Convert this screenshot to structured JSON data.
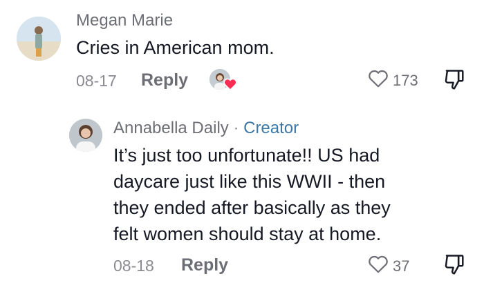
{
  "comments": [
    {
      "author": "Megan Marie",
      "text": "Cries in American mom.",
      "date": "08-17",
      "reply_label": "Reply",
      "like_count": "173",
      "creator_liked": true
    }
  ],
  "reply": {
    "author": "Annabella Daily",
    "badge_sep": " · ",
    "badge": "Creator",
    "text_lines": [
      "It’s just too unfortunate!! US had",
      "daycare just like this WWII - then",
      "they ended after basically as they",
      "felt women should stay at home."
    ],
    "date": "08-18",
    "reply_label": "Reply",
    "like_count": "37"
  },
  "colors": {
    "heart_red": "#fe2c55",
    "creator_blue": "#3b78a8",
    "muted_text": "#6d6e75"
  },
  "icons": {
    "like": "heart-outline-icon",
    "dislike": "thumbs-down-icon",
    "creator_liked": "creator-liked-heart-icon"
  }
}
